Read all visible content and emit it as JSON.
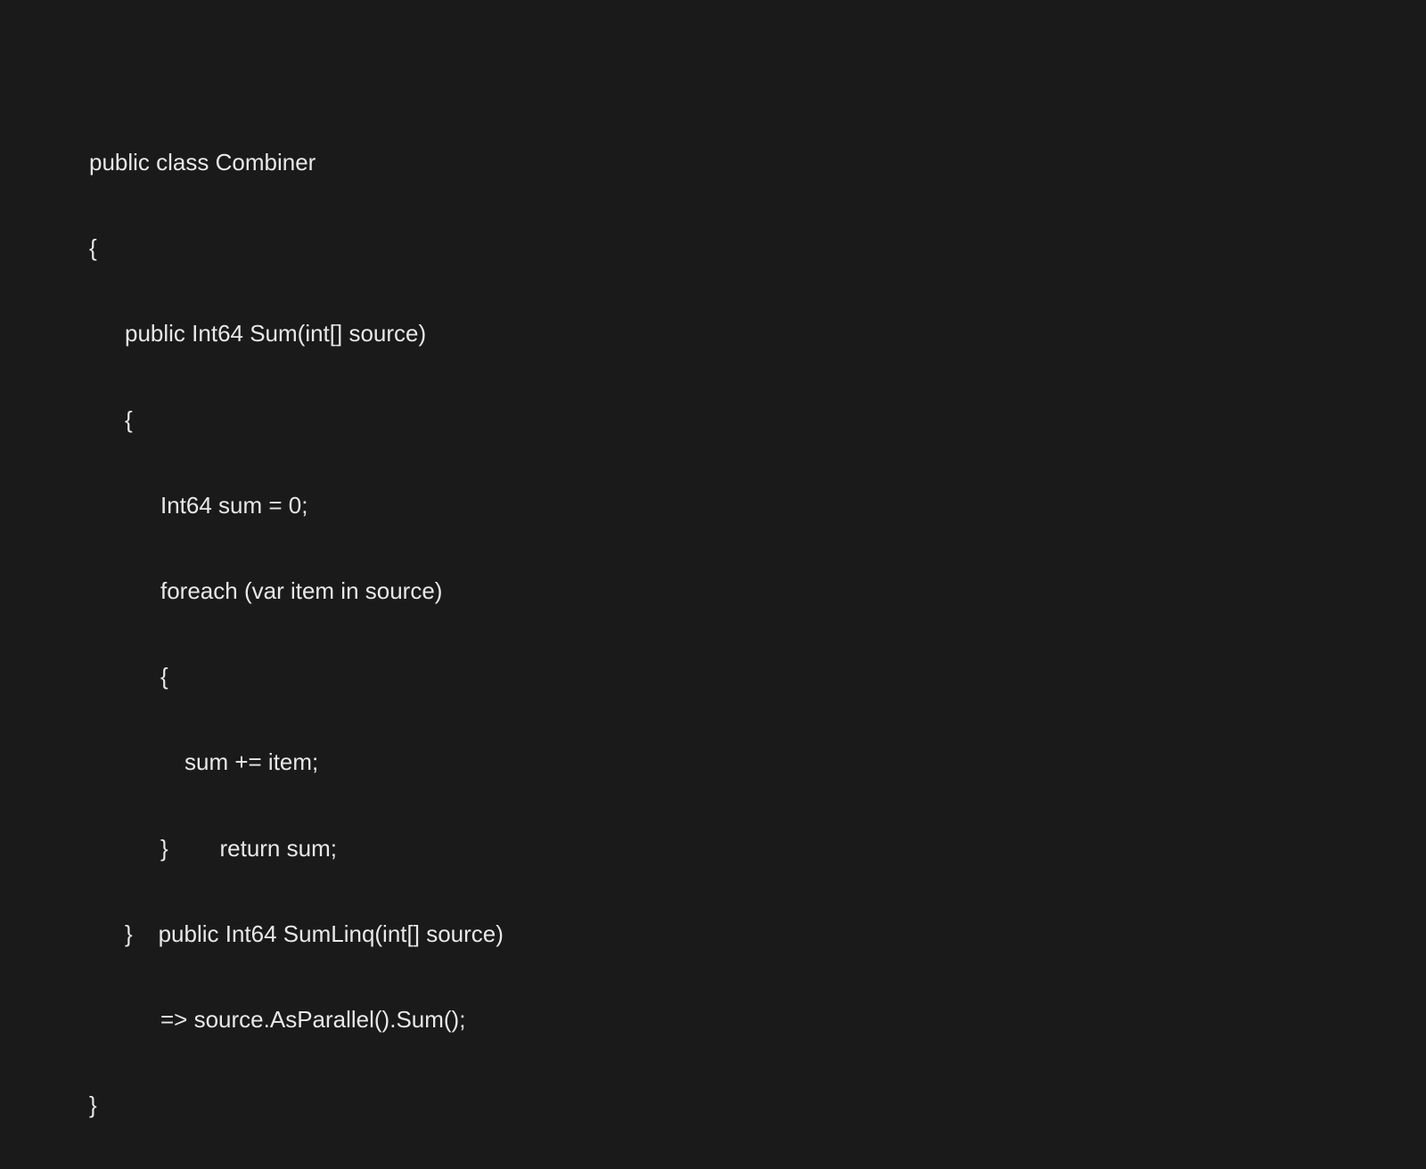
{
  "code": {
    "line1": "public class Combiner",
    "line2": "{",
    "line3": "public Int64 Sum(int[] source)",
    "line4": "{",
    "line5": "Int64 sum = 0;",
    "line6": "foreach (var item in source)",
    "line7": "{",
    "line8": "sum += item;",
    "line9": "}        return sum;",
    "line10": "}    public Int64 SumLinq(int[] source)",
    "line11": "=> source.AsParallel().Sum();",
    "line12": "}"
  }
}
